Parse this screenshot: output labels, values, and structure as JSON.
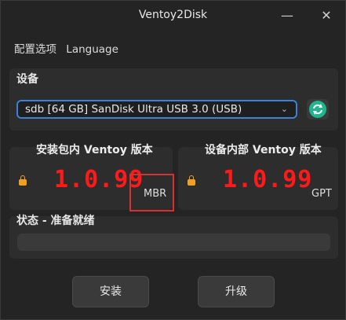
{
  "window": {
    "title": "Ventoy2Disk",
    "minimize_glyph": "—",
    "close_glyph": "✕"
  },
  "menu": {
    "items": [
      "配置选项",
      "Language"
    ]
  },
  "device": {
    "section_label": "设备",
    "selected": "sdb  [64 GB]  SanDisk Ultra USB 3.0 (USB)",
    "chevron_glyph": "⌄"
  },
  "package": {
    "title": "安装包内 Ventoy 版本",
    "version": "1.0.99",
    "part_style": "MBR"
  },
  "installed": {
    "title": "设备内部 Ventoy 版本",
    "version": "1.0.99",
    "part_style": "GPT"
  },
  "status": {
    "label": "状态 - 准备就绪",
    "progress": 0
  },
  "buttons": {
    "install": "安装",
    "update": "升级"
  },
  "colors": {
    "accent": "#3b82d6",
    "version": "#ff1a1a",
    "lock": "#f0a020",
    "refresh": "#1fb58f",
    "highlight_box": "#d63030"
  }
}
